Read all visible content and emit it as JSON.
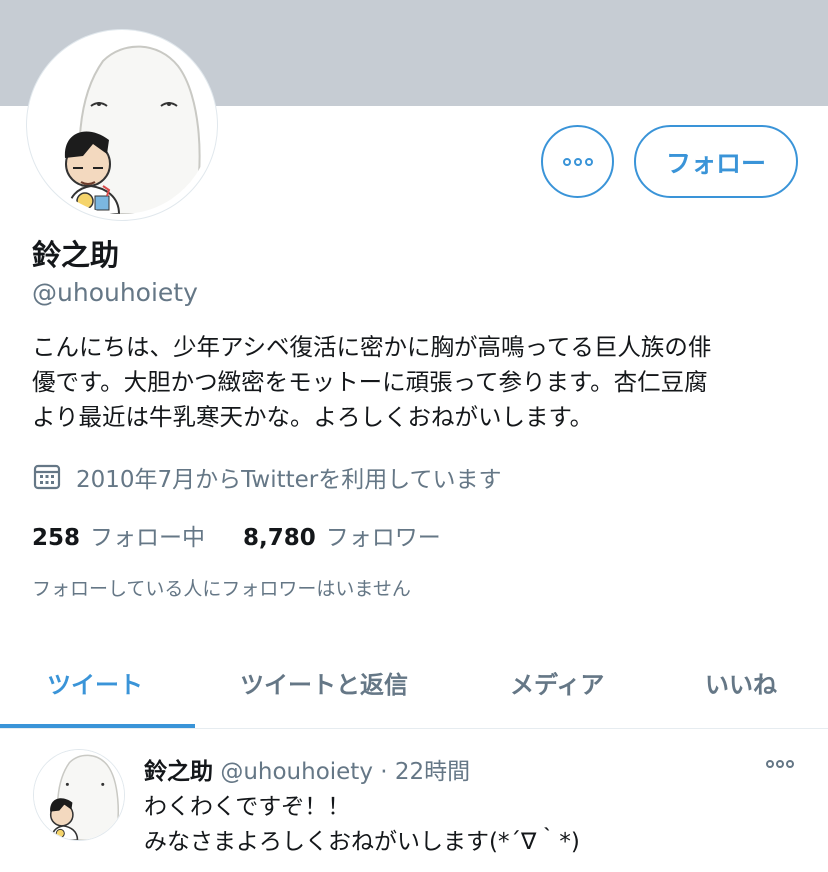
{
  "colors": {
    "accent": "#3a94d8",
    "banner": "#c6ccd3",
    "secondary_text": "#657786"
  },
  "profile": {
    "name": "鈴之助",
    "handle": "@uhouhoiety",
    "bio_lines": [
      "こんにちは、少年アシベ復活に密かに胸が高鳴ってる巨人族の俳",
      "優です。大胆かつ緻密をモットーに頑張って参ります。杏仁豆腐",
      "より最近は牛乳寒天かな。よろしくおねがいします。"
    ],
    "joined": "2010年7月からTwitterを利用しています",
    "stats": {
      "following_count": "258",
      "following_label": "フォロー中",
      "followers_count": "8,780",
      "followers_label": "フォロワー"
    },
    "followers_you_know": "フォローしている人にフォロワーはいません"
  },
  "actions": {
    "more_icon": "more-horizontal-icon",
    "follow_label": "フォロー"
  },
  "tabs": [
    {
      "label": "ツイート",
      "active": true
    },
    {
      "label": "ツイートと返信",
      "active": false
    },
    {
      "label": "メディア",
      "active": false
    },
    {
      "label": "いいね",
      "active": false
    }
  ],
  "tweet": {
    "name": "鈴之助",
    "handle": "@uhouhoiety",
    "separator": "·",
    "time": "22時間",
    "lines": [
      "わくわくですぞ！！",
      "みなさまよろしくおねがいします(*´∇｀*)"
    ]
  }
}
